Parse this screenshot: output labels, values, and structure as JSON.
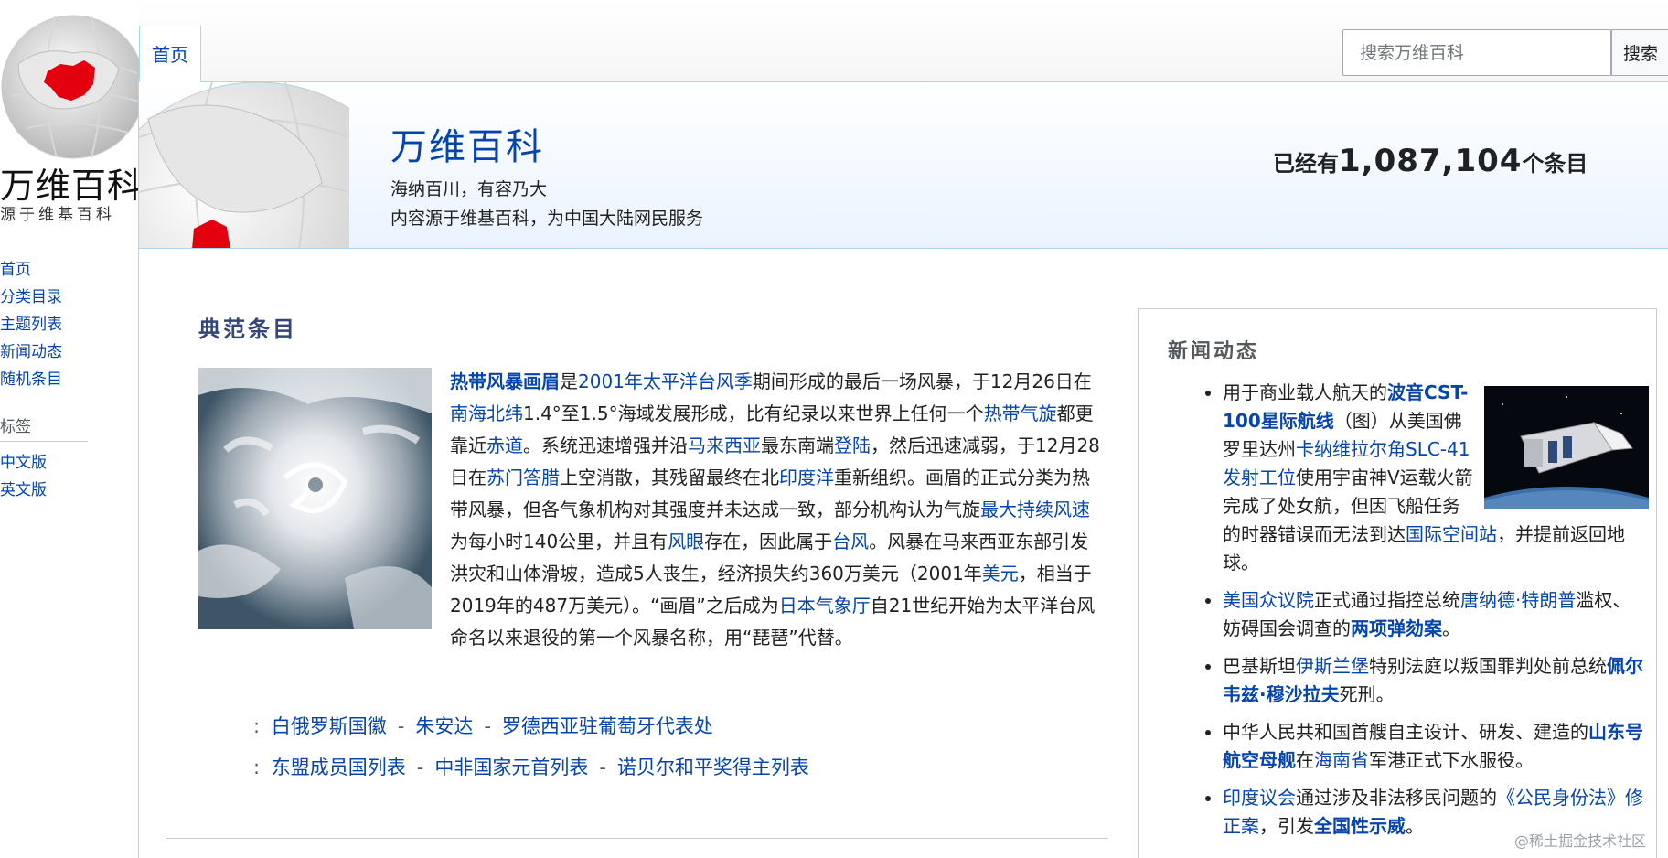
{
  "logo": {
    "title": "万维百科",
    "subtitle": "源于维基百科"
  },
  "nav": {
    "items": [
      "首页",
      "分类目录",
      "主题列表",
      "新闻动态",
      "随机条目"
    ],
    "tags_heading": "标签",
    "languages": [
      "中文版",
      "英文版"
    ]
  },
  "tabs": {
    "home": "首页"
  },
  "search": {
    "placeholder": "搜索万维百科",
    "button": "搜索"
  },
  "banner": {
    "title": "万维百科",
    "tagline": "海纳百川，有容乃大",
    "source": "内容源于维基百科，为中国大陆网民服务",
    "count_prefix": "已经有",
    "count": "1,087,104",
    "count_suffix": "个条目"
  },
  "featured": {
    "heading": "典范条目",
    "p": [
      "热带风暴画眉",
      "是",
      "2001年太平洋台风季",
      "期间形成的最后一场风暴，于12月26日在",
      "南海",
      "北纬",
      "1.4°至1.5°海域发展形成，比有纪录以来世界上任何一个",
      "热带气旋",
      "都更靠近",
      "赤道",
      "。系统迅速增强并沿",
      "马来西亚",
      "最东南端",
      "登陆",
      "，然后迅速减弱，于12月28日在",
      "苏门答腊",
      "上空消散，其残留最终在北",
      "印度洋",
      "重新组织。画眉的正式分类为热带风暴，但各气象机构对其强度并未达成一致，部分机构认为气旋",
      "最大持续风速",
      "为每小时140公里，并且有",
      "风眼",
      "存在，因此属于",
      "台风",
      "。风暴在马来西亚东部引发洪灾和山体滑坡，造成5人丧生，经济损失约360万美元（2001年",
      "美元",
      "，相当于2019年的487万美元）。“画眉”之后成为",
      "日本气象厅",
      "自21世纪开始为太平洋台风命名以来退役的第一个风暴名称，用“琵琶”代替。"
    ],
    "recent": [
      "白俄罗斯国徽",
      "朱安达",
      "罗德西亚驻葡萄牙代表处"
    ],
    "lists": [
      "东盟成员国列表",
      "中非国家元首列表",
      "诺贝尔和平奖得主列表"
    ],
    "colon": ":",
    "sep": "-"
  },
  "news": {
    "heading": "新闻动态",
    "i1": [
      "用于商业载人航天的",
      "波音CST-100星际航线",
      "（图）从美国佛罗里达州",
      "卡纳维拉尔角SLC-41发射工位",
      "使用宇宙神V运载火箭完成了处女航，但因飞船任务的时器错误而无法到达",
      "国际空间站",
      "，并提前返回地球。"
    ],
    "i2": [
      "美国众议院",
      "正式通过指控总统",
      "唐纳德·特朗普",
      "滥权、妨碍国会调查的",
      "两项弹劾案",
      "。"
    ],
    "i3": [
      "巴基斯坦",
      "伊斯兰堡",
      "特别法庭以叛国罪判处前总统",
      "佩尔韦兹·穆沙拉夫",
      "死刑。"
    ],
    "i4": [
      "中华人民共和国首艘自主设计、研发、建造的",
      "山东号航空母舰",
      "在",
      "海南省",
      "军港正式下水服役。"
    ],
    "i5": [
      "印度议会",
      "通过涉及非法移民问题的",
      "《公民身份法》修正案",
      "，引发",
      "全国性示威",
      "。"
    ]
  },
  "colors": {
    "link": "#0645ad",
    "heading": "#33467a",
    "border": "#a7d7f9",
    "accent": "#e3000f"
  },
  "watermark": "@稀土掘金技术社区"
}
